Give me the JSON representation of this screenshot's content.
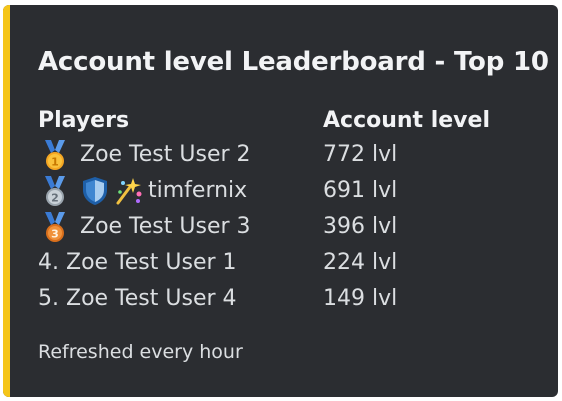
{
  "embed": {
    "accent_color": "#f5c518",
    "title": "Account level Leaderboard - Top 10",
    "players_header": "Players",
    "level_header": "Account level",
    "rows": [
      {
        "rank_icon": "gold-medal-icon",
        "badges": [],
        "prefix": "",
        "name": "Zoe Test User 2",
        "level": "772 lvl"
      },
      {
        "rank_icon": "silver-medal-icon",
        "badges": [
          "shield-badge-icon",
          "sparkle-badge-icon"
        ],
        "prefix": "",
        "name": "timfernix",
        "level": "691 lvl"
      },
      {
        "rank_icon": "bronze-medal-icon",
        "badges": [],
        "prefix": "",
        "name": "Zoe Test User 3",
        "level": "396 lvl"
      },
      {
        "rank_icon": "",
        "badges": [],
        "prefix": "4.",
        "name": "Zoe Test User 1",
        "level": "224 lvl"
      },
      {
        "rank_icon": "",
        "badges": [],
        "prefix": "5.",
        "name": "Zoe Test User 4",
        "level": "149 lvl"
      }
    ],
    "footer": "Refreshed every hour"
  }
}
